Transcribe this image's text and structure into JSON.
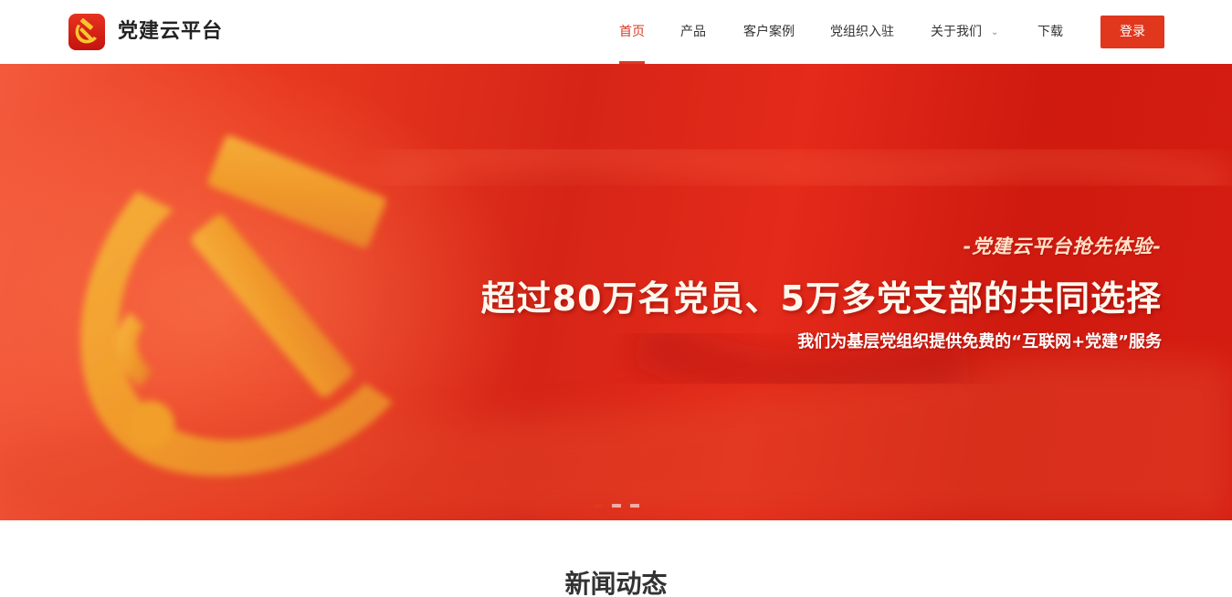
{
  "site": {
    "name": "党建云平台",
    "accent_color": "#e0371d"
  },
  "nav": {
    "items": [
      {
        "label": "首页",
        "active": true
      },
      {
        "label": "产品"
      },
      {
        "label": "客户案例"
      },
      {
        "label": "党组织入驻"
      },
      {
        "label": "关于我们",
        "has_dropdown": true
      },
      {
        "label": "下载"
      }
    ],
    "login_label": "登录",
    "dropdown_icon": "chevron-down-icon"
  },
  "banner": {
    "subtitle": "-党建云平台抢先体验-",
    "title": "超过80万名党员、5万多党支部的共同选择",
    "description": "我们为基层党组织提供免费的“互联网+党建”服务",
    "emblem_icon": "hammer-sickle-icon",
    "slides_total": 3,
    "active_slide": 1
  },
  "news": {
    "title": "新闻动态"
  }
}
